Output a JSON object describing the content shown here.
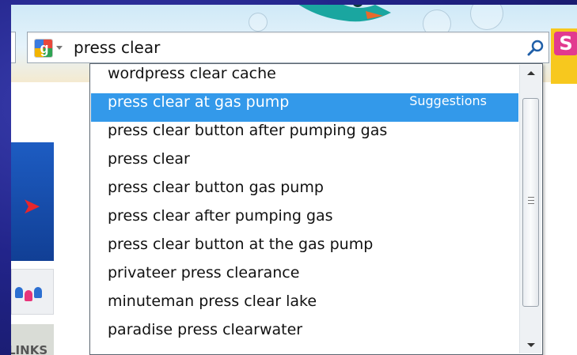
{
  "search": {
    "provider_icon": "google-g-icon",
    "query": "press clear",
    "button_icon": "magnifier-icon"
  },
  "suggestions": {
    "items": [
      {
        "text": "wordpress clear cache",
        "tag": ""
      },
      {
        "text": "press clear at gas pump",
        "tag": "Suggestions"
      },
      {
        "text": "press clear button after pumping gas",
        "tag": ""
      },
      {
        "text": "press clear",
        "tag": ""
      },
      {
        "text": "press clear button gas pump",
        "tag": ""
      },
      {
        "text": "press clear after pumping gas",
        "tag": ""
      },
      {
        "text": "press clear button at the gas pump",
        "tag": ""
      },
      {
        "text": "privateer press clearance",
        "tag": ""
      },
      {
        "text": "minuteman press clear lake",
        "tag": ""
      },
      {
        "text": "paradise press clearwater",
        "tag": ""
      }
    ],
    "selected_index": 1
  },
  "page": {
    "links_tab": "LINKS",
    "colors": {
      "selection": "#3399ea",
      "side_block": "#1d5cc2",
      "arrow": "#e8262c"
    }
  }
}
